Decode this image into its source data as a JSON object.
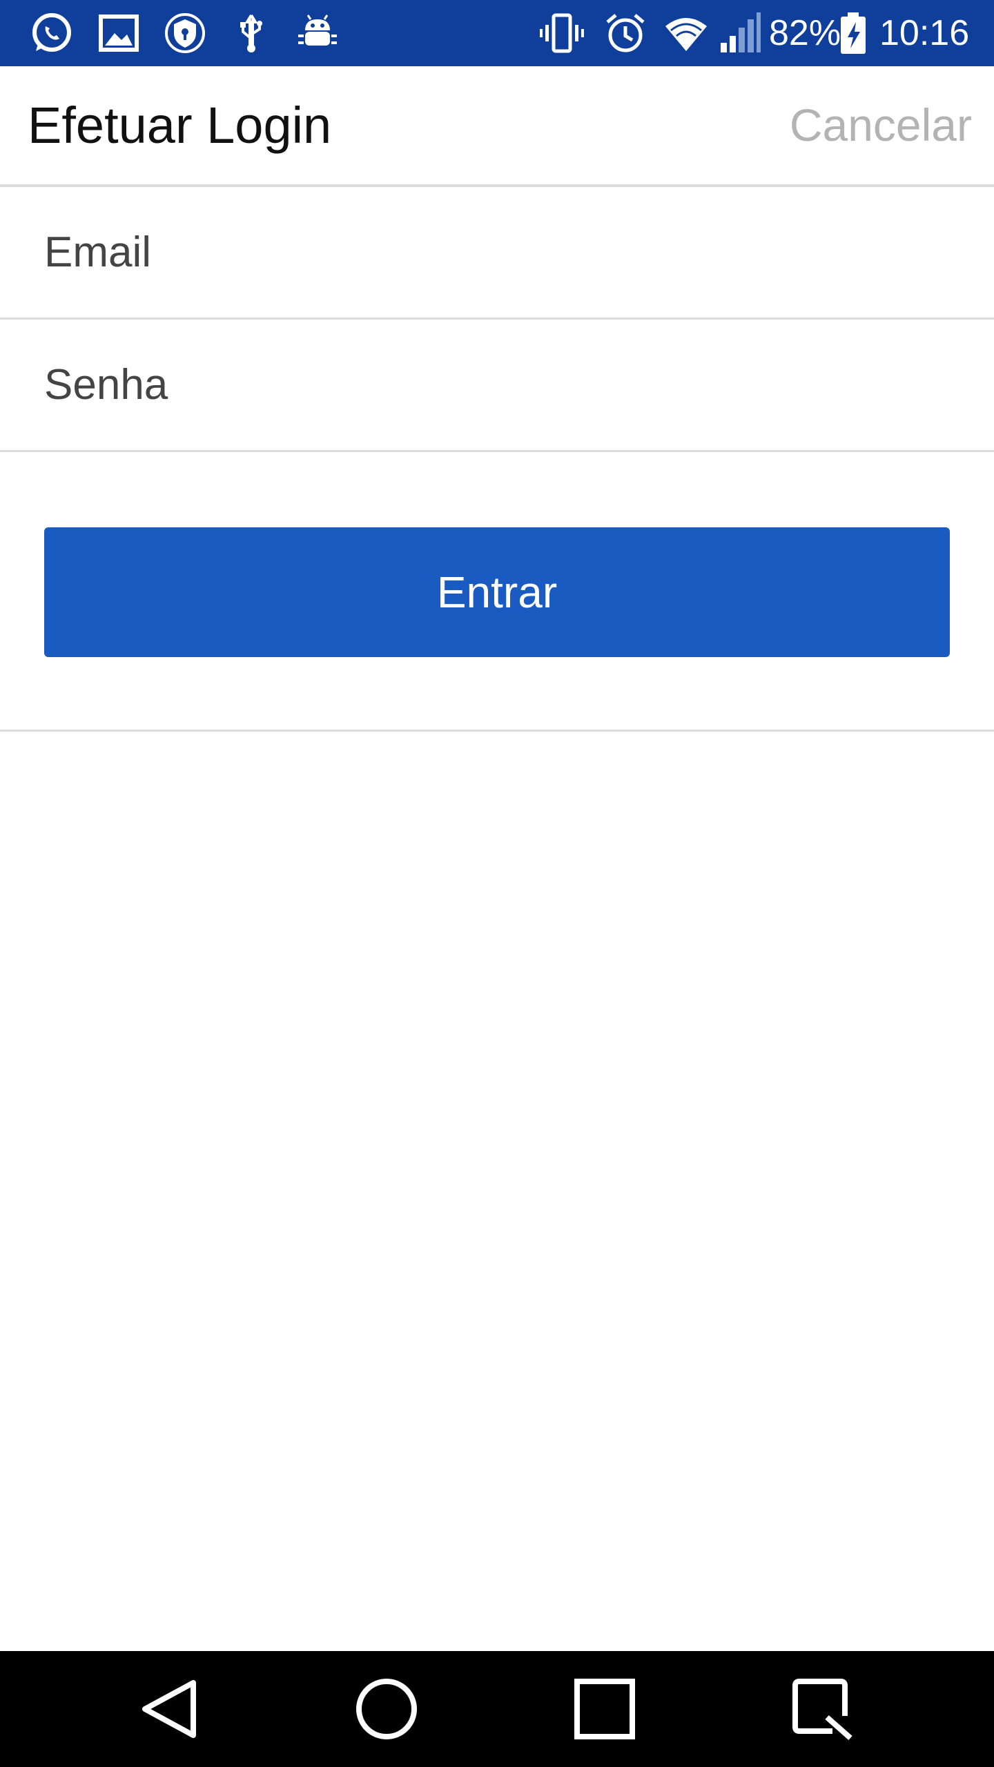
{
  "status_bar": {
    "battery": "82%",
    "time": "10:16",
    "left_icons": [
      "whatsapp-icon",
      "gallery-icon",
      "shield-icon",
      "usb-icon",
      "android-debug-icon"
    ],
    "right_icons": [
      "vibrate-icon",
      "alarm-icon",
      "wifi-icon",
      "signal-icon",
      "battery-charging-icon"
    ],
    "background_color": "#0f3f9b"
  },
  "header": {
    "title": "Efetuar Login",
    "cancel_label": "Cancelar"
  },
  "form": {
    "email": {
      "placeholder": "Email",
      "value": ""
    },
    "password": {
      "placeholder": "Senha",
      "value": ""
    },
    "submit_label": "Entrar"
  },
  "nav_bar": {
    "buttons": [
      "back-icon",
      "home-icon",
      "recents-icon",
      "screenshot-icon"
    ]
  },
  "colors": {
    "accent": "#1a5bc2",
    "divider": "#dcdcdc",
    "cancel_text": "#b3b3b3"
  }
}
